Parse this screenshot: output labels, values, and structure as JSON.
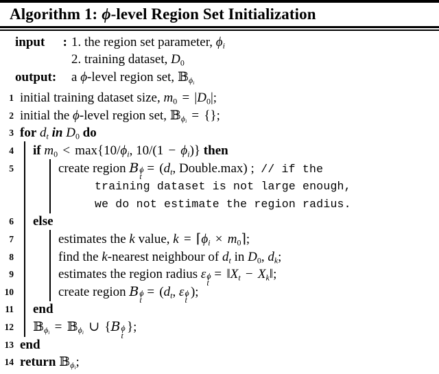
{
  "algorithm": {
    "label": "Algorithm 1:",
    "title": "φ-level Region Set Initialization",
    "title_plain": "Algorithm 1: φ-level Region Set Initialization",
    "io": {
      "input_label": "input",
      "input_sep": ":",
      "input_items": [
        "1. the region set parameter, φᵢ",
        "2. training dataset, D₀"
      ],
      "output_label": "output:",
      "output_value": "a φ-level region set, 𝔹_φᵢ"
    },
    "lines": [
      {
        "no": "1",
        "indent": 0,
        "text": "initial training dataset size, m₀ = |D₀|;"
      },
      {
        "no": "2",
        "indent": 0,
        "text": "initial the φ-level region set, 𝔹_φᵢ = {};"
      },
      {
        "no": "3",
        "indent": 0,
        "text": "for dt in D₀ do"
      },
      {
        "no": "4",
        "indent": 1,
        "text": "if m₀ < max{10/φᵢ, 10/(1 − φᵢ)} then"
      },
      {
        "no": "5",
        "indent": 2,
        "text": "create region 𝓑ₜ^φᵢ = (dt, Double.max) ;",
        "comment": "// if the training dataset is not large enough, we do not estimate the region radius.",
        "comment_lines": [
          "// if the",
          "training dataset is not large enough,",
          "we do not estimate the region radius."
        ]
      },
      {
        "no": "6",
        "indent": 1,
        "text": "else"
      },
      {
        "no": "7",
        "indent": 2,
        "text": "estimates the k value, k = ⌈φᵢ × m₀⌉;"
      },
      {
        "no": "8",
        "indent": 2,
        "text": "find the k-nearest neighbour of dt in D₀, d_k;"
      },
      {
        "no": "9",
        "indent": 2,
        "text": "estimates the region radius εₜ^φᵢ = ‖Xₜ − X_k‖;"
      },
      {
        "no": "10",
        "indent": 2,
        "text": "create region 𝓑ₜ^φᵢ = (dt, εₜ^φᵢ);"
      },
      {
        "no": "11",
        "indent": 1,
        "text": "end"
      },
      {
        "no": "12",
        "indent": 1,
        "text": "𝔹_φᵢ = 𝔹_φᵢ ∪ {𝓑ₜ^φᵢ};"
      },
      {
        "no": "13",
        "indent": 0,
        "text": "end"
      },
      {
        "no": "14",
        "indent": 0,
        "text": "return 𝔹_φᵢ;"
      }
    ],
    "keywords": {
      "for": "for",
      "in": "in",
      "do": "do",
      "if": "if",
      "then": "then",
      "else": "else",
      "end": "end",
      "return": "return",
      "max": "max",
      "double_max": "Double.max"
    },
    "symbols": {
      "phi": "φ",
      "epsilon": "ε",
      "blackboard_b": "𝔹",
      "script_b": "𝓑",
      "union": "∪",
      "times": "×",
      "minus": "−",
      "less_than": "<",
      "equals": "="
    },
    "colors": {
      "text": "#000000",
      "background": "#ffffff",
      "rule": "#000000"
    }
  }
}
